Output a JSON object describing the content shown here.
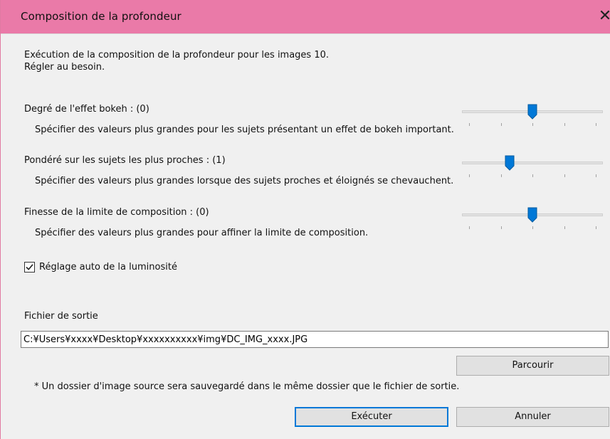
{
  "window": {
    "title": "Composition de la profondeur",
    "close_glyph": "✕",
    "accent_color": "#ea7aa8"
  },
  "intro": {
    "line1": "Exécution de la composition de la profondeur pour les images 10.",
    "line2": "Régler au besoin."
  },
  "sliders": [
    {
      "label": "Degré de l'effet bokeh : (0)",
      "hint": "Spécifier des valeurs plus grandes pour les sujets présentant un effet de bokeh important.",
      "value": 0,
      "position_fraction": 0.5
    },
    {
      "label": "Pondéré sur les sujets les plus proches : (1)",
      "hint": "Spécifier des valeurs plus grandes lorsque des sujets proches et éloignés se chevauchent.",
      "value": 1,
      "position_fraction": 0.34
    },
    {
      "label": "Finesse de la limite de composition : (0)",
      "hint": "Spécifier des valeurs plus grandes pour affiner la limite de composition.",
      "value": 0,
      "position_fraction": 0.5
    }
  ],
  "auto_brightness": {
    "label": "Réglage auto de la luminosité",
    "checked": true
  },
  "output": {
    "label": "Fichier de sortie",
    "path": "C:¥Users¥xxxx¥Desktop¥xxxxxxxxxx¥img¥DC_IMG_xxxx.JPG",
    "browse_label": "Parcourir",
    "note": "* Un dossier d'image source sera sauvegardé dans le même dossier que le fichier de sortie."
  },
  "buttons": {
    "execute": "Exécuter",
    "cancel": "Annuler"
  },
  "colors": {
    "slider_thumb": "#0078d7",
    "default_button_border": "#0078d7"
  }
}
